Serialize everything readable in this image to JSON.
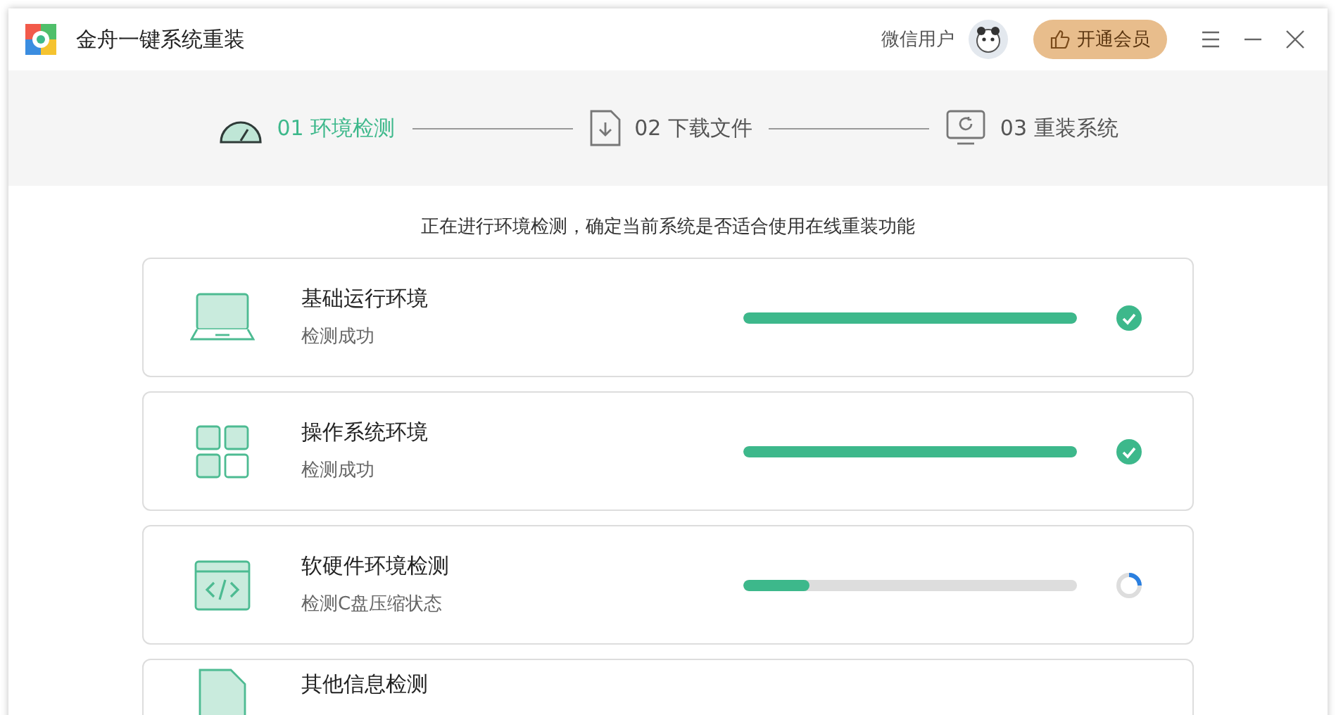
{
  "window": {
    "title": "金舟一键系统重装",
    "user": "微信用户",
    "vip_button": "开通会员"
  },
  "steps": [
    {
      "number": "01",
      "label": "环境检测",
      "kind": "gauge",
      "selected": true
    },
    {
      "number": "02",
      "label": "下载文件",
      "kind": "download",
      "selected": false
    },
    {
      "number": "03",
      "label": "重装系统",
      "kind": "monitor",
      "selected": false
    }
  ],
  "notice": "正在进行环境检测，确定当前系统是否适合使用在线重装功能",
  "checks": [
    {
      "kind": "laptop",
      "title": "基础运行环境",
      "status_text": "检测成功",
      "level": 1,
      "done": true
    },
    {
      "kind": "grid",
      "title": "操作系统环境",
      "status_text": "检测成功",
      "level": 1,
      "done": true
    },
    {
      "kind": "code",
      "title": "软硬件环境检测",
      "status_text": "检测C盘压缩状态",
      "level": 0.2,
      "done": false
    },
    {
      "kind": "file",
      "title": "其他信息检测"
    }
  ]
}
